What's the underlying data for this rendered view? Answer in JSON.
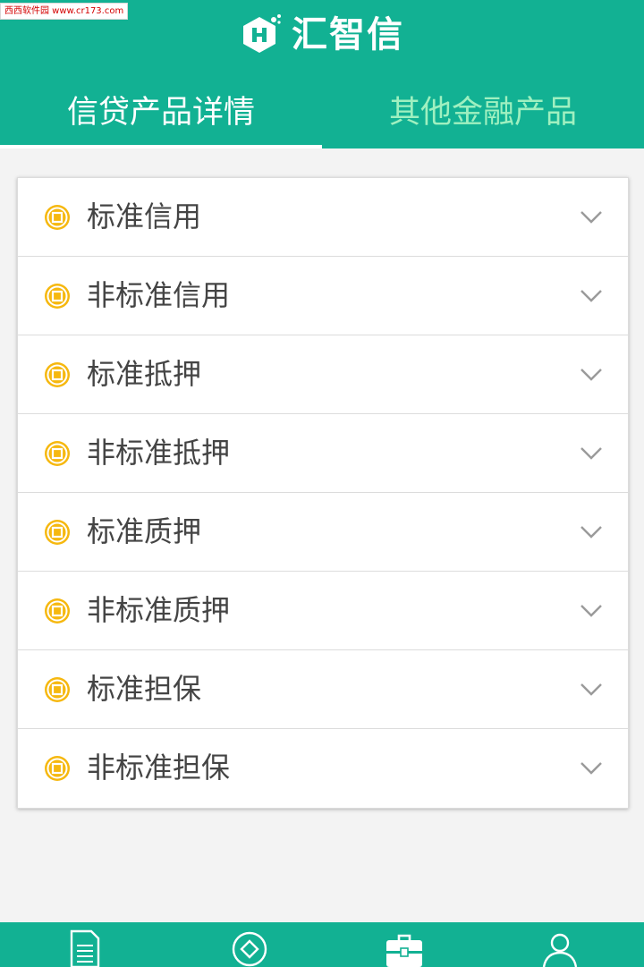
{
  "watermark": "西西软件园 www.cr173.com",
  "app": {
    "title": "汇智信"
  },
  "tabs": [
    {
      "label": "信贷产品详情",
      "active": true
    },
    {
      "label": "其他金融产品",
      "active": false
    }
  ],
  "products": [
    {
      "label": "标准信用",
      "icon": "coin-icon",
      "expand_icon": "chevron-down-icon"
    },
    {
      "label": "非标准信用",
      "icon": "coin-icon",
      "expand_icon": "chevron-down-icon"
    },
    {
      "label": "标准抵押",
      "icon": "coin-icon",
      "expand_icon": "chevron-down-icon"
    },
    {
      "label": "非标准抵押",
      "icon": "coin-icon",
      "expand_icon": "chevron-down-icon"
    },
    {
      "label": "标准质押",
      "icon": "coin-icon",
      "expand_icon": "chevron-down-icon"
    },
    {
      "label": "非标准质押",
      "icon": "coin-icon",
      "expand_icon": "chevron-down-icon"
    },
    {
      "label": "标准担保",
      "icon": "coin-icon",
      "expand_icon": "chevron-down-icon"
    },
    {
      "label": "非标准担保",
      "icon": "coin-icon",
      "expand_icon": "chevron-down-icon"
    }
  ],
  "bottom_nav": [
    {
      "icon": "document-icon"
    },
    {
      "icon": "diamond-icon"
    },
    {
      "icon": "briefcase-icon",
      "active": true
    },
    {
      "icon": "user-icon"
    }
  ],
  "colors": {
    "brand": "#12b193",
    "inactive_tab": "#9ff0c0",
    "coin": "#f6b80f",
    "chevron": "#9a9a9a"
  }
}
